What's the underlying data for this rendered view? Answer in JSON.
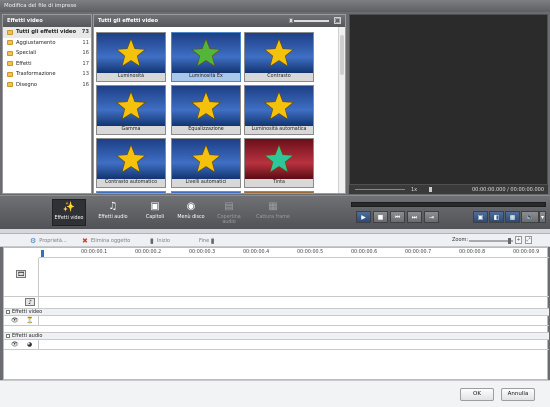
{
  "window": {
    "title": "Modifica del file di imprese"
  },
  "categories": {
    "header": "Effetti video",
    "items": [
      {
        "label": "Tutti gli effetti video",
        "count": "73"
      },
      {
        "label": "Aggiustamento",
        "count": "11"
      },
      {
        "label": "Speciali",
        "count": "16"
      },
      {
        "label": "Effetti",
        "count": "17"
      },
      {
        "label": "Trasformazione",
        "count": "13"
      },
      {
        "label": "Disegno",
        "count": "16"
      }
    ]
  },
  "effects": {
    "header": "Tutti gli effetti video",
    "items": [
      {
        "label": "Luminosità",
        "star": "#f4c20d",
        "bg": "blue"
      },
      {
        "label": "Luminosità Ex",
        "star": "#52b63b",
        "bg": "blue",
        "selected": true
      },
      {
        "label": "Contrasto",
        "star": "#f4c20d",
        "bg": "blue"
      },
      {
        "label": "Gamma",
        "star": "#f4c20d",
        "bg": "blue"
      },
      {
        "label": "Equalizzazione",
        "star": "#f4c20d",
        "bg": "blue"
      },
      {
        "label": "Luminosità automatica",
        "star": "#f4c20d",
        "bg": "blue"
      },
      {
        "label": "Contrasto automatico",
        "star": "#f4c20d",
        "bg": "blue"
      },
      {
        "label": "Livelli automatici",
        "star": "#f4c20d",
        "bg": "blue"
      },
      {
        "label": "Tinta",
        "star": "#2ec79a",
        "bg": "red"
      }
    ]
  },
  "preview": {
    "speed": "1x",
    "time": "00:00:00.000 / 00:00:00.000"
  },
  "toolbar": {
    "buttons": [
      {
        "label": "Effetti video",
        "icon": "video-effects-icon",
        "glyph": "✨",
        "state": "active"
      },
      {
        "label": "Effetti audio",
        "icon": "audio-effects-icon",
        "glyph": "♫",
        "state": "normal"
      },
      {
        "label": "Capitoli",
        "icon": "chapters-icon",
        "glyph": "▣",
        "state": "normal"
      },
      {
        "label": "Menù disco",
        "icon": "disc-menu-icon",
        "glyph": "◉",
        "state": "normal"
      },
      {
        "label": "Copertina audio",
        "icon": "audio-cover-icon",
        "glyph": "▤",
        "state": "disabled"
      },
      {
        "label": "Cattura frame",
        "icon": "capture-frame-icon",
        "glyph": "▦",
        "state": "disabled"
      }
    ]
  },
  "timeline": {
    "tools": [
      {
        "label": "Proprietà...",
        "icon": "properties-icon",
        "glyph": "⚙"
      },
      {
        "label": "Elimina oggetto",
        "icon": "delete-object-icon",
        "glyph": "✖"
      },
      {
        "label": "Inizio",
        "icon": "start-marker-icon",
        "glyph": "▮"
      },
      {
        "label": "Fine",
        "icon": "end-marker-icon",
        "glyph": "▮"
      }
    ],
    "zoom_label": "Zoom:",
    "ruler": [
      "00:00:00.1",
      "00:00:00.2",
      "00:00:00.3",
      "00:00:00.4",
      "00:00:00.5",
      "00:00:00.6",
      "00:00:00.7",
      "00:00:00.8",
      "00:00:00.9"
    ],
    "video_effects_label": "Effetti video",
    "audio_effects_label": "Effetti audio"
  },
  "dialog": {
    "ok": "OK",
    "cancel": "Annulla"
  }
}
